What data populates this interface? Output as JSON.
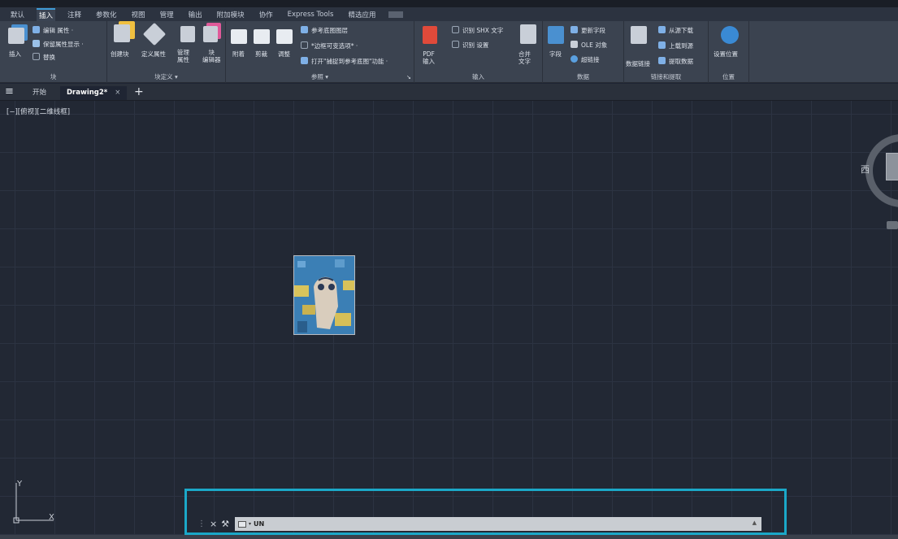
{
  "ribbon_tabs": [
    "默认",
    "插入",
    "注释",
    "参数化",
    "视图",
    "管理",
    "输出",
    "附加模块",
    "协作",
    "Express Tools",
    "精选应用"
  ],
  "active_tab": "插入",
  "panels": {
    "block": {
      "title": "块",
      "insert": "插入",
      "edit_attr": "编辑 属性 ·",
      "retain_attr": "保留属性显示 ·",
      "replace": "替换"
    },
    "block_def": {
      "title": "块定义 ▾",
      "create": "创建块",
      "define_attr": "定义属性",
      "manage_attr": "管理\n属性",
      "block_editor": "块\n编辑器"
    },
    "reference": {
      "title": "参照 ▾",
      "attach": "附着",
      "clip": "剪裁",
      "adjust": "调整",
      "underlay_layers": "参考底图图层",
      "frame_vary": "*边框可变选项* ·",
      "snap_underlay": "打开\"捕捉到参考底图\"功能 ·"
    },
    "import": {
      "title": "输入",
      "pdf_import": "PDF\n输入",
      "recognize_shx": "识别 SHX 文字",
      "recognize_settings": "识别 设置",
      "combine_text": "合并\n文字"
    },
    "data": {
      "title": "数据",
      "field": "字段",
      "update_fields": "更新字段",
      "ole_object": "OLE 对象",
      "hyperlink": "超链接"
    },
    "linking": {
      "title": "链接和提取",
      "data_link": "数据链接",
      "download_source": "从源下载",
      "upload_source": "上载到源",
      "extract_data": "提取数据"
    },
    "location": {
      "title": "位置",
      "set_location": "设置位置"
    }
  },
  "file_tabs": {
    "start": "开始",
    "drawing": "Drawing2*",
    "close": "×",
    "add": "+"
  },
  "viewport_label": "[−][俯视][二维线框]",
  "viewcube": {
    "west": "西"
  },
  "ucs": {
    "y": "Y",
    "x": "X"
  },
  "command_line": {
    "value": "UN",
    "close_icon": "×",
    "tool_icon": "wrench"
  }
}
